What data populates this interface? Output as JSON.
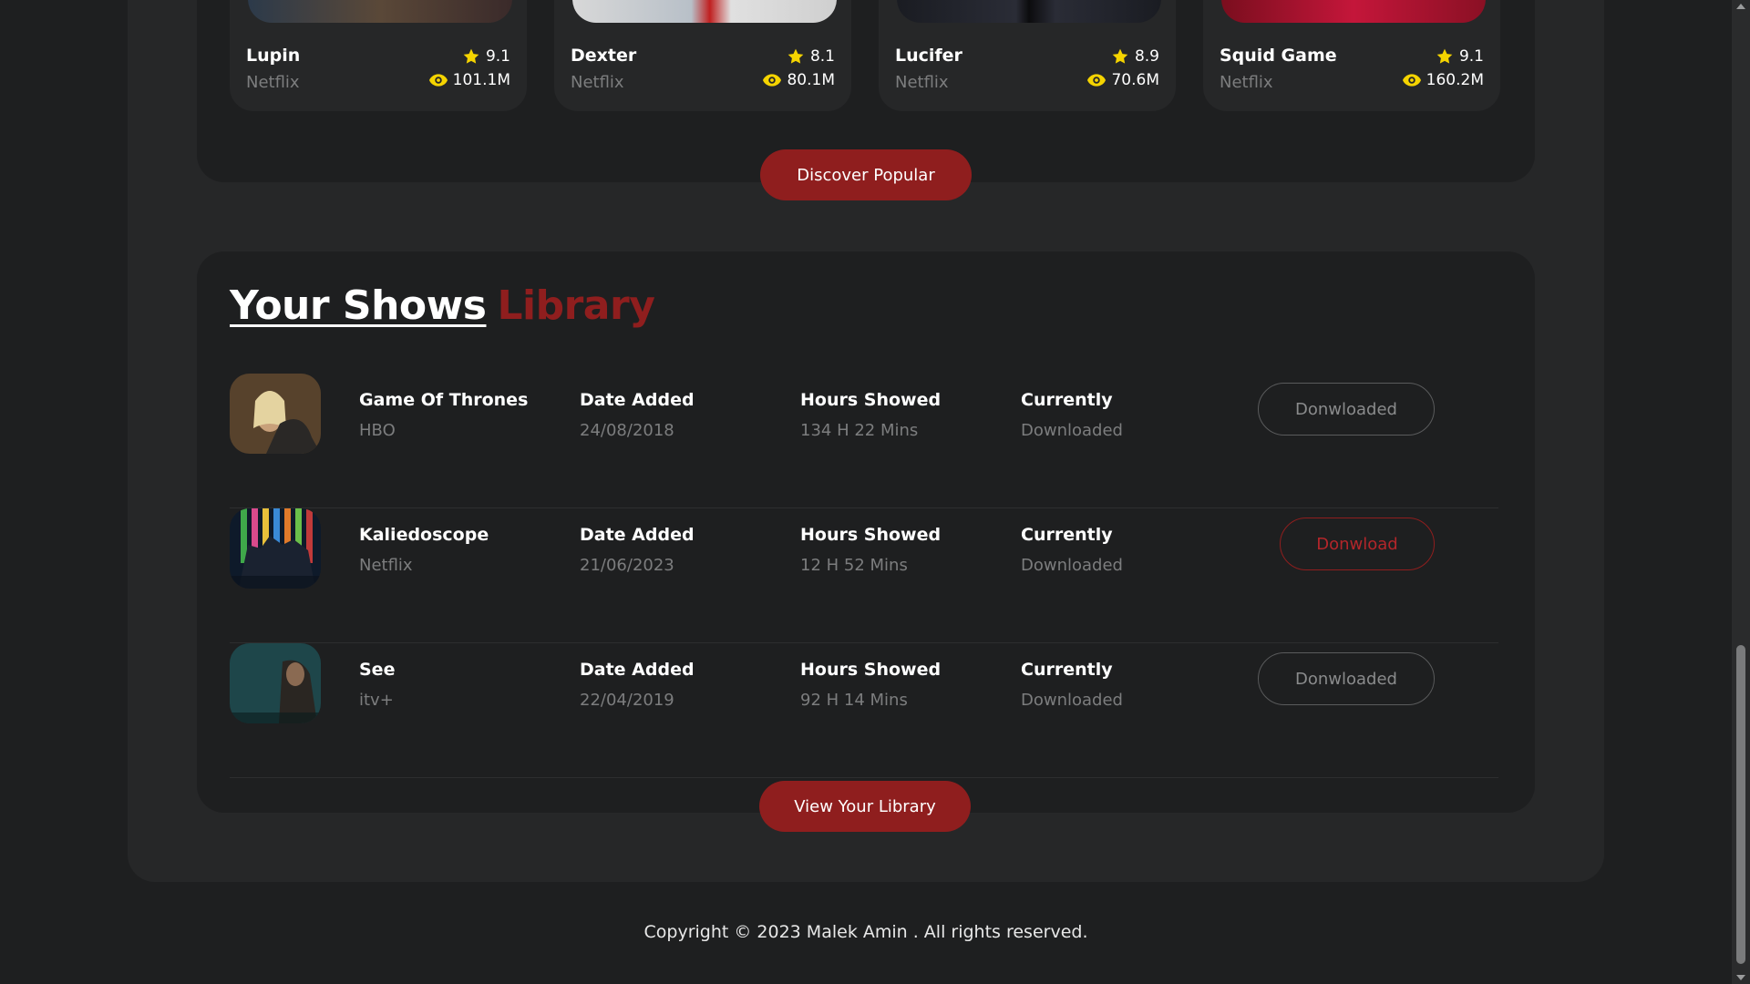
{
  "popular": {
    "cards": [
      {
        "title": "Lupin",
        "platform": "Netflix",
        "rating": "9.1",
        "views": "101.1M"
      },
      {
        "title": "Dexter",
        "platform": "Netflix",
        "rating": "8.1",
        "views": "80.1M"
      },
      {
        "title": "Lucifer",
        "platform": "Netflix",
        "rating": "8.9",
        "views": "70.6M"
      },
      {
        "title": "Squid Game",
        "platform": "Netflix",
        "rating": "9.1",
        "views": "160.2M"
      }
    ],
    "discover_label": "Discover Popular"
  },
  "library": {
    "title_main": "Your Shows",
    "title_accent": "Library",
    "rows": [
      {
        "title": "Game Of Thrones",
        "platform": "HBO",
        "date_label": "Date Added",
        "date": "24/08/2018",
        "hours_label": "Hours Showed",
        "hours": "134 H 22 Mins",
        "status_label": "Currently",
        "status": "Downloaded",
        "button": "Donwloaded"
      },
      {
        "title": "Kaliedoscope",
        "platform": "Netflix",
        "date_label": "Date Added",
        "date": "21/06/2023",
        "hours_label": "Hours Showed",
        "hours": "12 H 52 Mins",
        "status_label": "Currently",
        "status": "Downloaded",
        "button": "Donwload"
      },
      {
        "title": "See",
        "platform": "itv+",
        "date_label": "Date Added",
        "date": "22/04/2019",
        "hours_label": "Hours Showed",
        "hours": "92 H 14 Mins",
        "status_label": "Currently",
        "status": "Downloaded",
        "button": "Donwloaded"
      }
    ],
    "view_label": "View Your Library"
  },
  "footer": {
    "copyright": "Copyright © 2023 Malek Amin . All rights reserved."
  },
  "colors": {
    "accent": "#8f1e1e",
    "star": "#f5d400",
    "muted": "#7c7d7e"
  }
}
